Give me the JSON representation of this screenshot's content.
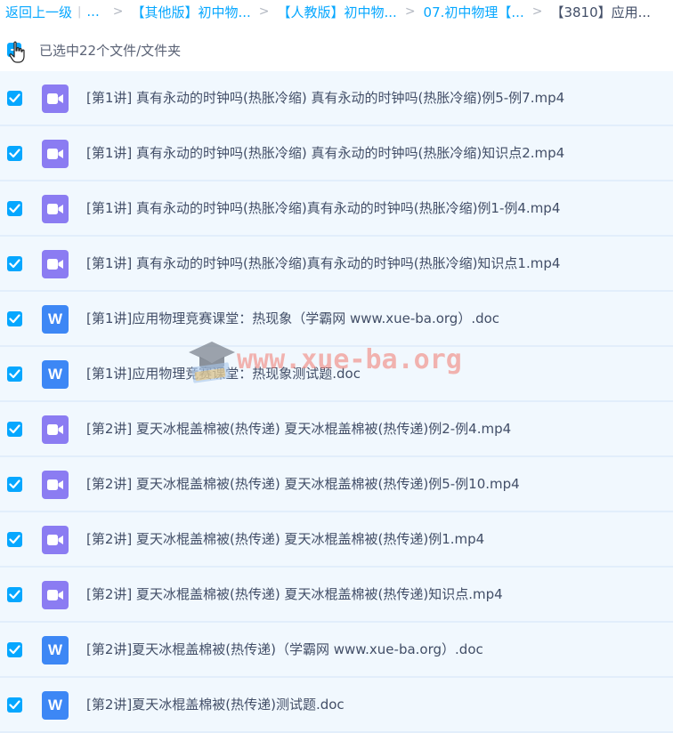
{
  "breadcrumb": {
    "back_label": "返回上一级",
    "pipe": "|",
    "ellipsis": "...",
    "separator": ">",
    "crumbs": [
      "【其他版】初中物...",
      "【人教版】初中物...",
      "07.初中物理【..."
    ],
    "current": "【3810】应用..."
  },
  "selection": {
    "status_text": "已选中22个文件/文件夹"
  },
  "files": [
    {
      "name": "[第1讲] 真有永动的时钟吗(热胀冷缩) 真有永动的时钟吗(热胀冷缩)例5-例7.mp4",
      "type": "video"
    },
    {
      "name": "[第1讲] 真有永动的时钟吗(热胀冷缩) 真有永动的时钟吗(热胀冷缩)知识点2.mp4",
      "type": "video"
    },
    {
      "name": "[第1讲] 真有永动的时钟吗(热胀冷缩)真有永动的时钟吗(热胀冷缩)例1-例4.mp4",
      "type": "video"
    },
    {
      "name": "[第1讲] 真有永动的时钟吗(热胀冷缩)真有永动的时钟吗(热胀冷缩)知识点1.mp4",
      "type": "video"
    },
    {
      "name": "[第1讲]应用物理竞赛课堂：热现象（学霸网 www.xue-ba.org）.doc",
      "type": "doc"
    },
    {
      "name": "[第1讲]应用物理竞赛课堂：热现象测试题.doc",
      "type": "doc"
    },
    {
      "name": "[第2讲] 夏天冰棍盖棉被(热传递) 夏天冰棍盖棉被(热传递)例2-例4.mp4",
      "type": "video"
    },
    {
      "name": "[第2讲] 夏天冰棍盖棉被(热传递) 夏天冰棍盖棉被(热传递)例5-例10.mp4",
      "type": "video"
    },
    {
      "name": "[第2讲] 夏天冰棍盖棉被(热传递) 夏天冰棍盖棉被(热传递)例1.mp4",
      "type": "video"
    },
    {
      "name": "[第2讲] 夏天冰棍盖棉被(热传递) 夏天冰棍盖棉被(热传递)知识点.mp4",
      "type": "video"
    },
    {
      "name": "[第2讲]夏天冰棍盖棉被(热传递)（学霸网 www.xue-ba.org）.doc",
      "type": "doc"
    },
    {
      "name": "[第2讲]夏天冰棍盖棉被(热传递)测试题.doc",
      "type": "doc"
    }
  ],
  "icons": {
    "video": "video-file-icon",
    "doc": "word-doc-icon",
    "doc_glyph": "W"
  },
  "watermark": {
    "text": "www.xue-ba.org"
  },
  "colors": {
    "accent": "#06a7ff",
    "row_bg": "#f1f8fe",
    "video_icon": "#8b7cf2",
    "doc_icon": "#3d87f5"
  }
}
